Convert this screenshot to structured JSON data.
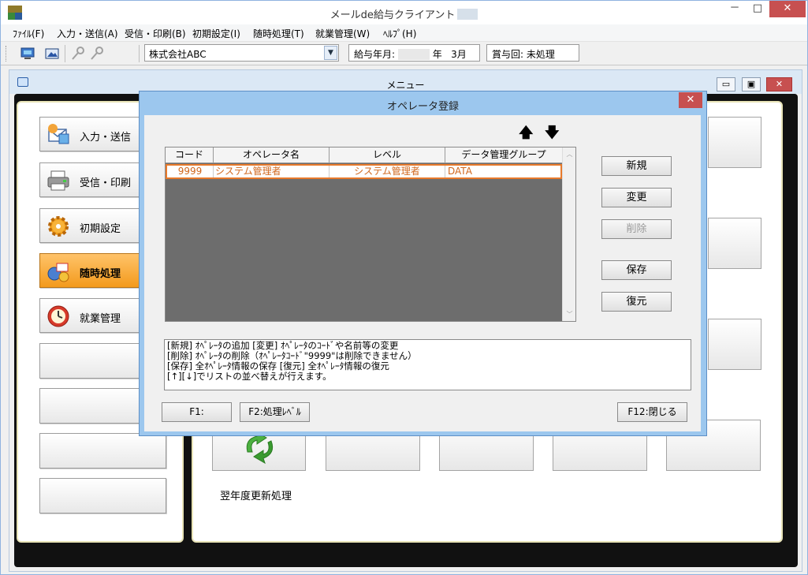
{
  "window": {
    "title": "メールde給与クライアント",
    "controls": {
      "minimize": "－",
      "maximize": "□",
      "close": "✕"
    }
  },
  "menubar": [
    "ﾌｧｲﾙ(F)",
    "入力・送信(A)",
    "受信・印刷(B)",
    "初期設定(I)",
    "随時処理(T)",
    "就業管理(W)",
    "ﾍﾙﾌﾟ(H)"
  ],
  "toolbar": {
    "company": "株式会社ABC",
    "pay_year_label": "給与年月:",
    "pay_year_suffix": "年",
    "pay_month": "3月",
    "bonus_label": "賞与回:",
    "bonus_value": "未処理"
  },
  "menu_window": {
    "title": "メニュー",
    "left_items": [
      {
        "label": "入力・送信",
        "icon": "envelope-icon"
      },
      {
        "label": "受信・印刷",
        "icon": "printer-icon"
      },
      {
        "label": "初期設定",
        "icon": "gear-icon"
      },
      {
        "label": "随時処理",
        "icon": "tools-icon",
        "active": true
      },
      {
        "label": "就業管理",
        "icon": "clock-icon"
      }
    ],
    "tile_label": "翌年度更新処理",
    "colors": {
      "active": "#f39a1c",
      "panel_border": "#e9e4b8"
    }
  },
  "dialog": {
    "title": "オペレータ登録",
    "close": "✕",
    "up_arrow": "🡅",
    "down_arrow": "🡇",
    "columns": [
      "コード",
      "オペレータ名",
      "レベル",
      "データ管理グループ"
    ],
    "rows": [
      {
        "code": "9999",
        "name": "システム管理者",
        "level": "システム管理者",
        "group": "DATA"
      }
    ],
    "buttons": {
      "new": "新規",
      "change": "変更",
      "delete": "削除",
      "save": "保存",
      "restore": "復元"
    },
    "help_lines": [
      "[新規] ｵﾍﾟﾚｰﾀの追加 [変更] ｵﾍﾟﾚｰﾀのｺｰﾄﾞや名前等の変更",
      "[削除] ｵﾍﾟﾚｰﾀの削除（ｵﾍﾟﾚｰﾀｺｰﾄﾞ\"9999\"は削除できません）",
      "[保存] 全ｵﾍﾟﾚｰﾀ情報の保存 [復元] 全ｵﾍﾟﾚｰﾀ情報の復元",
      "[↑][↓]でリストの並べ替えが行えます。"
    ],
    "function_buttons": {
      "f1": "F1:",
      "f2": "F2:処理ﾚﾍﾞﾙ",
      "f12": "F12:閉じる"
    },
    "colors": {
      "selection": "#e87a2b",
      "row_text": "#d0661c",
      "grid_bg": "#6d6d6d",
      "frame": "#9cc7ee"
    }
  }
}
